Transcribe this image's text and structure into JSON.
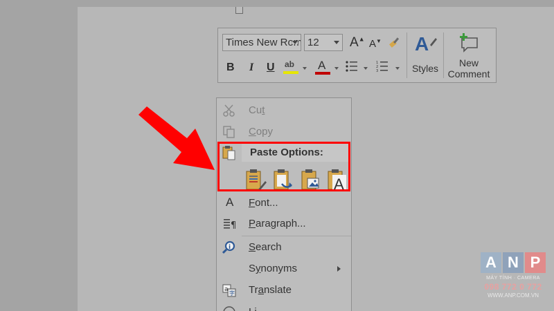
{
  "toolbar": {
    "font_name": "Times New Roman",
    "font_size": "12",
    "bold": "B",
    "italic": "I",
    "underline": "U",
    "highlight_glyph": "ab",
    "font_color_glyph": "A",
    "styles_label": "Styles",
    "new_comment_line1": "New",
    "new_comment_line2": "Comment"
  },
  "context_menu": {
    "cut": {
      "accel": "t",
      "pre": "Cu",
      "post": "",
      "disabled": true
    },
    "copy": {
      "accel": "C",
      "pre": "",
      "post": "opy",
      "disabled": true
    },
    "paste_options_label": "Paste Options:",
    "paste_options": [
      "keep-source-formatting",
      "merge-formatting",
      "picture",
      "keep-text-only"
    ],
    "font": {
      "accel": "F",
      "post": "ont..."
    },
    "paragraph": {
      "accel": "P",
      "post": "aragraph..."
    },
    "search": {
      "accel": "S",
      "post": "earch"
    },
    "synonyms": {
      "accel": "y",
      "pre": "S",
      "post": "nonyms"
    },
    "translate": {
      "pre": "Tr",
      "accel": "a",
      "post": "nslate"
    },
    "link_partial": "Li"
  },
  "logo": {
    "letters": [
      "A",
      "N",
      "P"
    ],
    "tagline": "MÁY TÍNH · CAMERA",
    "phone": "098 772 0 772",
    "website": "WWW.ANP.COM.VN",
    "colors": {
      "a": "#9fb2c6",
      "n": "#8fa2ba",
      "p": "#e18b8b"
    }
  },
  "colors": {
    "highlight": "#ff0000",
    "arrow": "#ff0000"
  }
}
